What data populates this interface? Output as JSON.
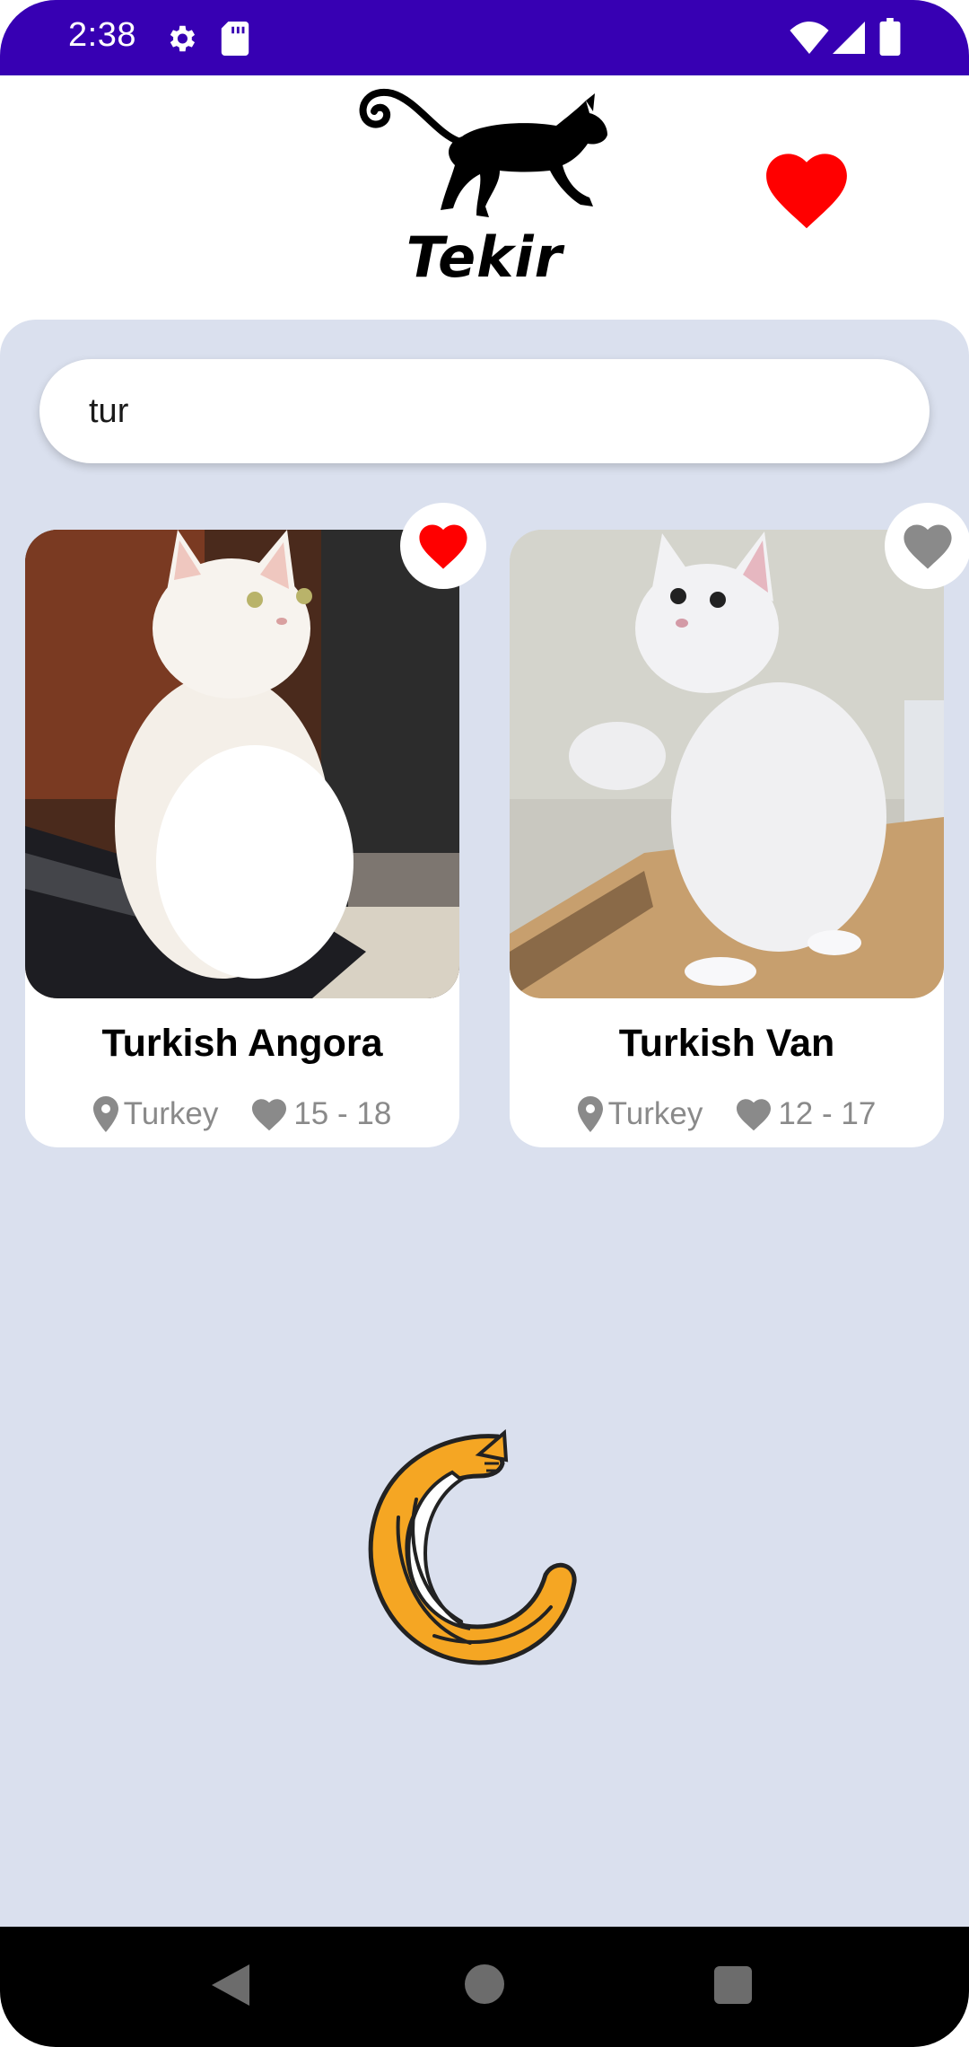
{
  "status_bar": {
    "time": "2:38",
    "icons": [
      "gear-icon",
      "sd-card-icon",
      "wifi-icon",
      "signal-icon",
      "battery-icon"
    ],
    "background": "#3700b3"
  },
  "header": {
    "logo_text": "Tekir",
    "favorites_icon": "heart-icon",
    "favorites_color": "#ff0000"
  },
  "search": {
    "value": "tur"
  },
  "breeds": [
    {
      "name": "Turkish Angora",
      "origin": "Turkey",
      "life_span": "15 - 18",
      "favorite": true
    },
    {
      "name": "Turkish Van",
      "origin": "Turkey",
      "life_span": "12 - 17",
      "favorite": false
    }
  ],
  "loader": {
    "icon": "cat-loading-icon",
    "color": "#f5a623"
  },
  "nav_bar": {
    "buttons": [
      "back",
      "home",
      "recents"
    ]
  },
  "colors": {
    "content_bg": "#dae0ee",
    "fav_active": "#ff0000",
    "fav_inactive": "#8a8a8a"
  }
}
